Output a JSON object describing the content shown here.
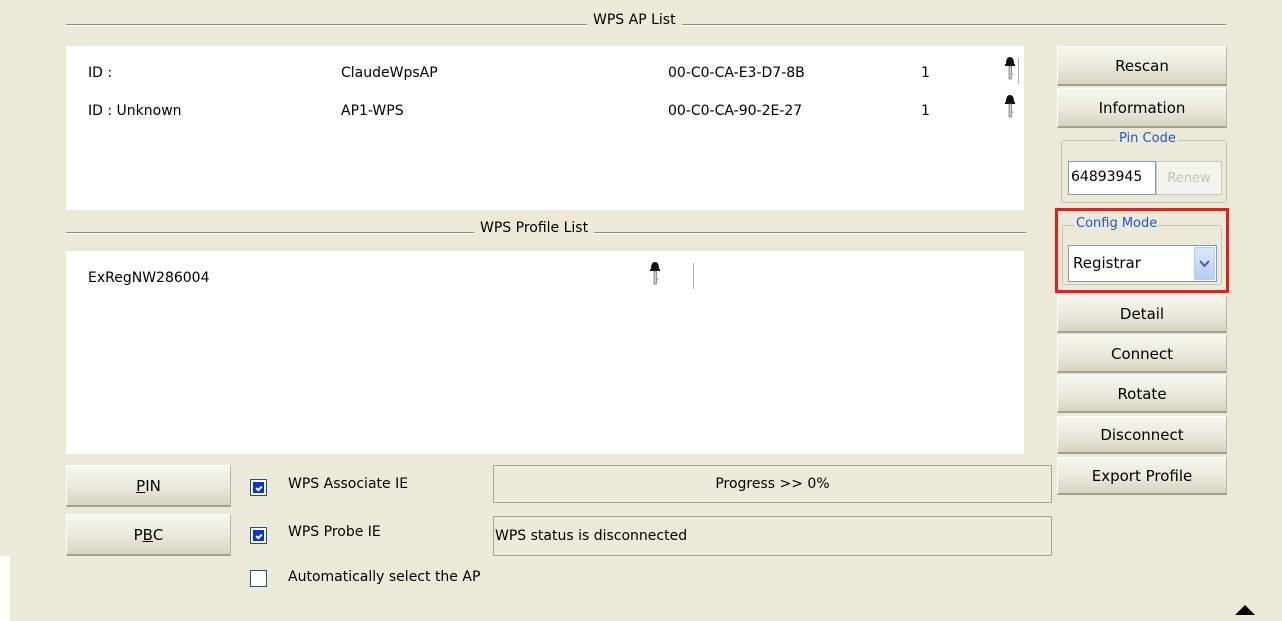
{
  "ap_list": {
    "title": "WPS AP List",
    "rows": [
      {
        "id": "ID :",
        "ssid": "ClaudeWpsAP",
        "bssid": "00-C0-CA-E3-D7-8B",
        "channel": "1"
      },
      {
        "id": "ID : Unknown",
        "ssid": "AP1-WPS",
        "bssid": "00-C0-CA-90-2E-27",
        "channel": "1"
      }
    ]
  },
  "profile_list": {
    "title": "WPS Profile List",
    "rows": [
      {
        "name": "ExRegNW286004"
      }
    ]
  },
  "buttons": {
    "rescan": "Rescan",
    "information": "Information",
    "detail": "Detail",
    "connect": "Connect",
    "rotate": "Rotate",
    "disconnect": "Disconnect",
    "export_profile": "Export Profile",
    "pin_prefix": "",
    "pin_mnemonic": "P",
    "pin_rest": "IN",
    "pbc_prefix": "P",
    "pbc_mnemonic": "B",
    "pbc_rest": "C"
  },
  "pin_code": {
    "legend": "Pin Code",
    "value": "64893945",
    "renew_label": "Renew"
  },
  "config_mode": {
    "legend": "Config Mode",
    "selected": "Registrar"
  },
  "options": {
    "wps_associate_ie": {
      "label": "WPS Associate IE",
      "checked": true
    },
    "wps_probe_ie": {
      "label": "WPS Probe IE",
      "checked": true
    },
    "auto_select_ap": {
      "label": "Automatically select the AP",
      "checked": false
    }
  },
  "status": {
    "progress": "Progress >> 0%",
    "message": "WPS status is disconnected"
  },
  "colors": {
    "window_bg": "#ece9d8",
    "accent_legend": "#2156d1",
    "highlight_border": "#e61e1e",
    "checkbox_fill": "#0a33d8"
  },
  "icons": {
    "security": "key-icon",
    "dropdown": "chevron-down-icon",
    "collapse": "triangle-up-icon"
  }
}
